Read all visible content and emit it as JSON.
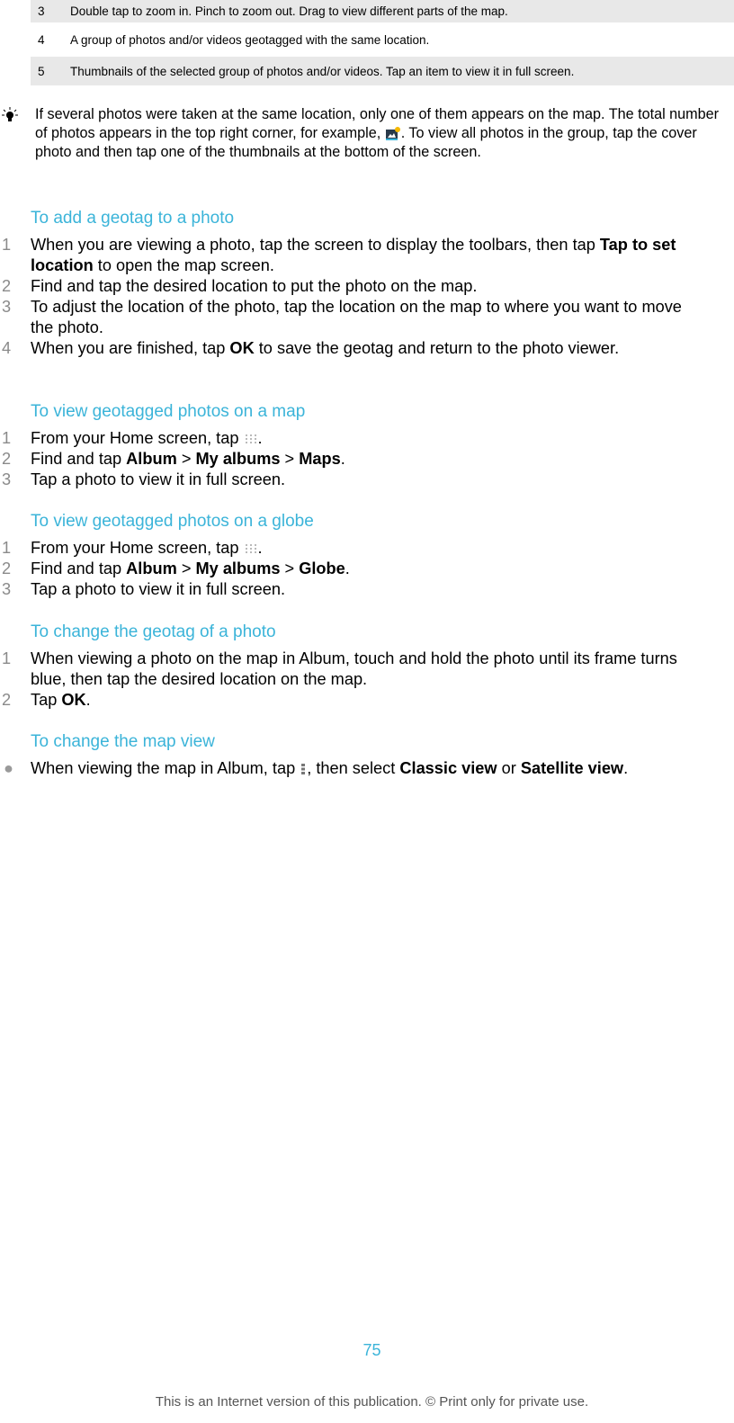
{
  "legend_table": {
    "rows": [
      {
        "num": "3",
        "text": "Double tap to zoom in. Pinch to zoom out. Drag to view different parts of the map."
      },
      {
        "num": "4",
        "text": "A group of photos and/or videos geotagged with the same location."
      },
      {
        "num": "5",
        "text": "Thumbnails of the selected group of photos and/or videos. Tap an item to view it in full screen."
      }
    ]
  },
  "tip": {
    "icon": "lightbulb-icon",
    "text_before": "If several photos were taken at the same location, only one of them appears on the map. The total number of photos appears in the top right corner, for example, ",
    "inline_icon": "photo-count-icon",
    "text_after": ". To view all photos in the group, tap the cover photo and then tap one of the thumbnails at the bottom of the screen."
  },
  "sections": [
    {
      "title": "To add a geotag to a photo",
      "steps": [
        {
          "n": "1",
          "a": "When you are viewing a photo, tap the screen to display the toolbars, then tap ",
          "b1": "Tap to set location",
          "c": " to open the map screen."
        },
        {
          "n": "2",
          "a": "Find and tap the desired location to put the photo on the map."
        },
        {
          "n": "3",
          "a": "To adjust the location of the photo, tap the location on the map to where you want to move the photo."
        },
        {
          "n": "4",
          "a": "When you are finished, tap ",
          "b1": "OK",
          "c": " to save the geotag and return to the photo viewer."
        }
      ]
    },
    {
      "title": "To view geotagged photos on a map",
      "steps": [
        {
          "n": "1",
          "a": "From your Home screen, tap ",
          "icon": "apps-grid-icon",
          "c": "."
        },
        {
          "n": "2",
          "a": "Find and tap ",
          "b1": "Album",
          "sep1": " > ",
          "b2": "My albums",
          "sep2": " > ",
          "b3": "Maps",
          "c": "."
        },
        {
          "n": "3",
          "a": "Tap a photo to view it in full screen."
        }
      ]
    },
    {
      "title": "To view geotagged photos on a globe",
      "steps": [
        {
          "n": "1",
          "a": "From your Home screen, tap ",
          "icon": "apps-grid-icon",
          "c": "."
        },
        {
          "n": "2",
          "a": "Find and tap ",
          "b1": "Album",
          "sep1": " > ",
          "b2": "My albums",
          "sep2": " > ",
          "b3": "Globe",
          "c": "."
        },
        {
          "n": "3",
          "a": "Tap a photo to view it in full screen."
        }
      ]
    },
    {
      "title": "To change the geotag of a photo",
      "steps": [
        {
          "n": "1",
          "a": "When viewing a photo on the map in Album, touch and hold the photo until its frame turns blue, then tap the desired location on the map."
        },
        {
          "n": "2",
          "a": "Tap ",
          "b1": "OK",
          "c": "."
        }
      ]
    },
    {
      "title": "To change the map view",
      "bullets": [
        {
          "a": "When viewing the map in Album, tap ",
          "icon": "menu-more-icon",
          "c1": ", then select ",
          "b1": "Classic view",
          "c2": " or ",
          "b2": "Satellite view",
          "c3": "."
        }
      ]
    }
  ],
  "page_number": "75",
  "footer": "This is an Internet version of this publication. © Print only for private use.",
  "colors": {
    "heading": "#3bb4d9",
    "table_row_gray": "#e8e8e8",
    "step_number": "#8a8a8a"
  }
}
